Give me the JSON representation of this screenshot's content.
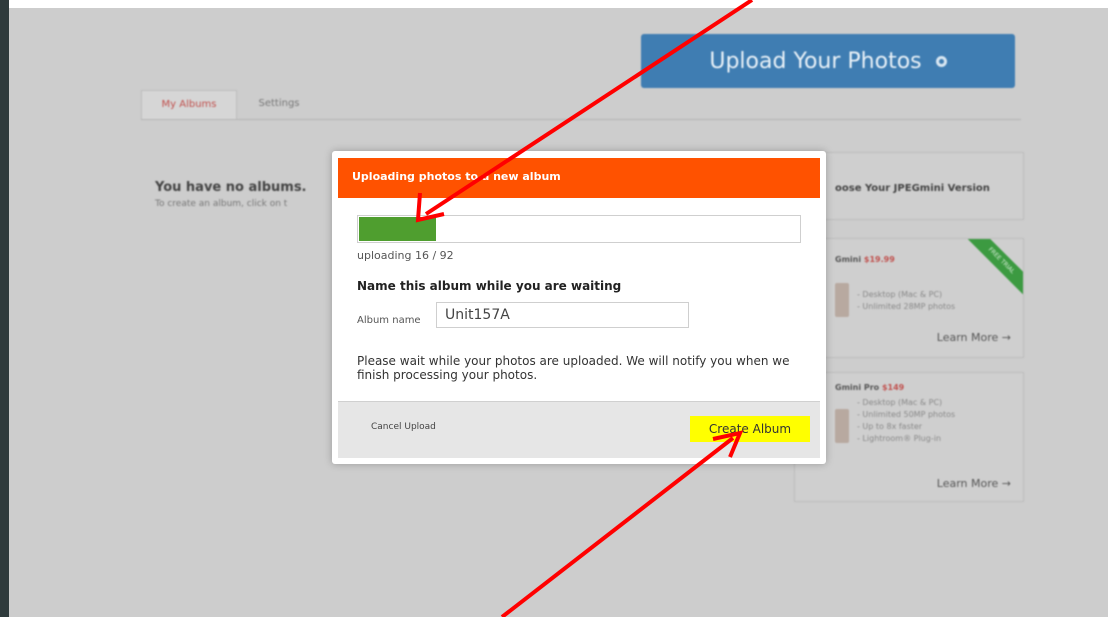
{
  "page": {
    "upload_button": "Upload Your Photos",
    "tabs": [
      {
        "label": "My Albums"
      },
      {
        "label": "Settings"
      }
    ],
    "no_albums_title": "You have no albums.",
    "no_albums_subtitle": "To create an album, click on t",
    "sidebar": {
      "title": "oose Your JPEGmini Version",
      "products": [
        {
          "name": "Gmini",
          "price": "$19.99",
          "features": [
            "- Desktop (Mac & PC)",
            "- Unlimited 28MP photos"
          ],
          "link": "Learn More →",
          "ribbon": "FREE TRIAL"
        },
        {
          "name": "Gmini Pro",
          "price": "$149",
          "features": [
            "- Desktop (Mac & PC)",
            "- Unlimited 50MP photos",
            "- Up to 8x faster",
            "- Lightroom® Plug-in"
          ],
          "link": "Learn More →"
        }
      ]
    }
  },
  "modal": {
    "title": "Uploading photos to a new album",
    "progress": {
      "current": 16,
      "total": 92,
      "text": "uploading 16 / 92"
    },
    "name_heading": "Name this album while you are waiting",
    "album_label": "Album name",
    "album_value": "Unit157A",
    "wait_message": "Please wait while your photos are uploaded. We will notify you when we finish processing your photos.",
    "cancel_label": "Cancel Upload",
    "create_label": "Create Album"
  },
  "colors": {
    "header": "#ff5200",
    "progress_fill": "#4f9e2f",
    "create_highlight": "#ffff00",
    "annotation_arrow": "#ff0000",
    "upload_button": "#3f7db2"
  }
}
